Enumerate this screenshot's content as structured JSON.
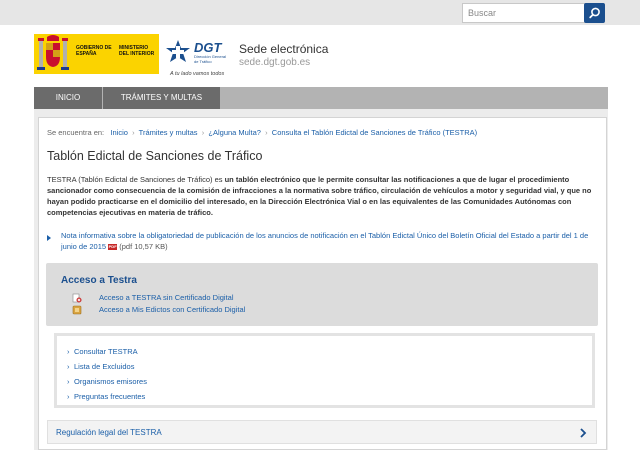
{
  "search": {
    "placeholder": "Buscar"
  },
  "header": {
    "gov_logo_line1": "GOBIERNO DE ESPAÑA",
    "gov_logo_line2": "MINISTERIO DEL INTERIOR",
    "dgt_word": "DGT",
    "dgt_sub": "Dirección General de Tráfico",
    "dgt_tagline": "A tu lado vamos todos",
    "site_title": "Sede electrónica",
    "site_url": "sede.dgt.gob.es"
  },
  "nav": {
    "items": [
      {
        "label": "INICIO"
      },
      {
        "label": "TRÁMITES Y MULTAS"
      }
    ]
  },
  "breadcrumb": {
    "prefix": "Se encuentra en:",
    "items": [
      "Inicio",
      "Trámites y multas",
      "¿Alguna Multa?",
      "Consulta el Tablón Edictal de Sanciones de Tráfico (TESTRA)"
    ]
  },
  "main": {
    "title": "Tablón Edictal de Sanciones de Tráfico",
    "intro_lead": "TESTRA (Tablón Edictal de Sanciones de Tráfico) es",
    "intro_bold": " un tablón electrónico que le permite consultar las notificaciones a que de lugar el procedimiento sancionador como consecuencia de la comisión de infracciones a la normativa sobre tráfico, circulación de vehículos a motor y seguridad vial, y que no hayan podido practicarse en el domicilio del interesado, en la Dirección Electrónica Vial o en las equivalentes de las Comunidades Autónomas con competencias ejecutivas en materia de tráfico.",
    "note_text": "Nota informativa sobre la obligatoriedad de publicación de los anuncios de notificación en el Tablón Edictal Único del Boletín Oficial del Estado a partir del 1 de junio de 2015",
    "note_pdf_badge": "PDF",
    "note_size": "(pdf 10,57 KB)"
  },
  "access": {
    "title": "Acceso a Testra",
    "links": [
      {
        "label": "Acceso a TESTRA sin Certificado Digital"
      },
      {
        "label": "Acceso a Mis Edictos con Certificado Digital"
      }
    ]
  },
  "links": [
    {
      "label": "Consultar TESTRA"
    },
    {
      "label": "Lista de Excluidos"
    },
    {
      "label": "Organismos emisores"
    },
    {
      "label": "Preguntas frecuentes"
    }
  ],
  "accordion": {
    "label": "Regulación legal del TESTRA"
  },
  "colors": {
    "accent": "#1b5fa8",
    "brand_dark": "#1b4f8e",
    "nav_active": "#6b6b6b",
    "gov_yellow": "#fbd300"
  },
  "icons": [
    "search-icon",
    "spain-coat-of-arms-icon",
    "dgt-logo-icon",
    "chevron-right-icon",
    "pdf-icon",
    "no-certificate-icon",
    "certificate-icon"
  ]
}
